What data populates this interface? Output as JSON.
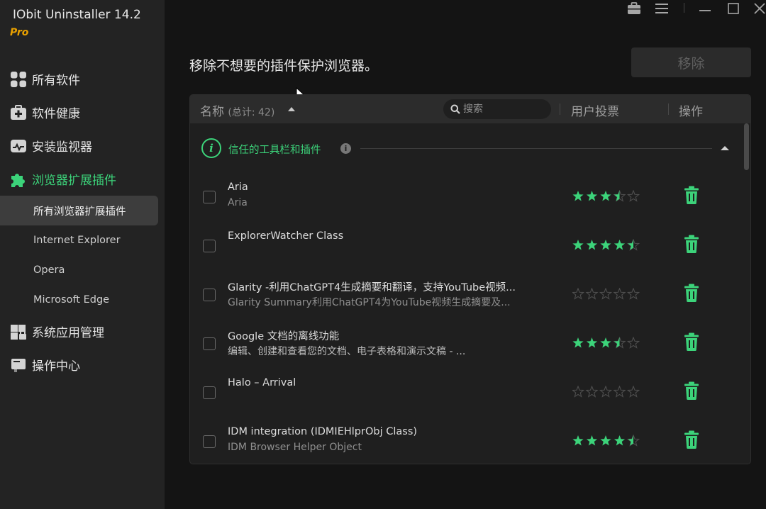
{
  "app": {
    "title": "IObit Uninstaller 14.2",
    "edition": "Pro"
  },
  "colors": {
    "accent": "#3cd37a",
    "edition": "#e8a000",
    "background": "#141414",
    "sidebar": "#232323"
  },
  "sidebar": {
    "items": [
      {
        "label": "所有软件",
        "icon": "apps-grid-icon"
      },
      {
        "label": "软件健康",
        "icon": "medkit-icon"
      },
      {
        "label": "安装监视器",
        "icon": "monitor-icon"
      },
      {
        "label": "浏览器扩展插件",
        "icon": "puzzle-icon",
        "active": true
      }
    ],
    "sub_items": [
      {
        "label": "所有浏览器扩展插件",
        "active": true
      },
      {
        "label": "Internet Explorer"
      },
      {
        "label": "Opera"
      },
      {
        "label": "Microsoft Edge"
      }
    ],
    "items_after": [
      {
        "label": "系统应用管理",
        "icon": "windows-lock-icon"
      },
      {
        "label": "操作中心",
        "icon": "action-center-icon"
      }
    ]
  },
  "window_controls": [
    "toolbox-icon",
    "menu-icon",
    "minimize-icon",
    "maximize-icon",
    "close-icon"
  ],
  "main": {
    "headline": "移除不想要的插件保护浏览器。",
    "remove_button": "移除"
  },
  "table": {
    "col_name": "名称",
    "col_count": "(总计: 42)",
    "search_placeholder": "搜索",
    "col_votes": "用户投票",
    "col_action": "操作",
    "group_title": "信任的工具栏和插件",
    "rows": [
      {
        "name": "Aria",
        "desc": "Aria",
        "rating": 3.5
      },
      {
        "name": "ExplorerWatcher Class",
        "desc": "",
        "rating": 4.5
      },
      {
        "name": "Glarity -利用ChatGPT4生成摘要和翻译，支持YouTube视频...",
        "desc": "Glarity Summary利用ChatGPT4为YouTube视频生成摘要及...",
        "rating": 0
      },
      {
        "name": "Google 文档的离线功能",
        "desc": "编辑、创建和查看您的文档、电子表格和演示文稿 - ...",
        "rating": 3.5
      },
      {
        "name": "Halo – Arrival",
        "desc": "",
        "rating": 0
      },
      {
        "name": "IDM integration (IDMIEHlprObj Class)",
        "desc": "IDM Browser Helper Object",
        "rating": 4.5
      }
    ]
  }
}
